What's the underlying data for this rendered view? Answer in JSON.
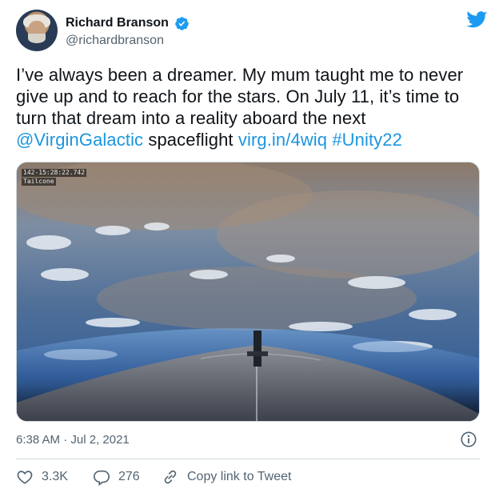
{
  "user": {
    "display_name": "Richard Branson",
    "handle": "@richardbranson",
    "verified": true
  },
  "tweet": {
    "text_part1": "I’ve always been a dreamer. My mum taught me to never give up and to reach for the stars. On July 11, it’s time to turn that dream into a reality aboard the next ",
    "mention": "@VirginGalactic",
    "text_part2": " spaceflight ",
    "url": "virg.in/4wiq",
    "space": " ",
    "hashtag": "#Unity22"
  },
  "media": {
    "overlay_line1": "142-15:28:22.742",
    "overlay_line2": "Tailcone"
  },
  "timestamp": "6:38 AM · Jul 2, 2021",
  "actions": {
    "likes": "3.3K",
    "replies": "276",
    "copy_link": "Copy link to Tweet"
  },
  "colors": {
    "link": "#1b95e0",
    "brand": "#1d9bf0",
    "text": "#0f1419",
    "secondary": "#536471"
  },
  "icons": {
    "verified": "verified-badge-icon",
    "brand": "twitter-bird-icon",
    "info": "info-icon",
    "like": "heart-icon",
    "reply": "reply-bubble-icon",
    "copy": "link-icon"
  }
}
